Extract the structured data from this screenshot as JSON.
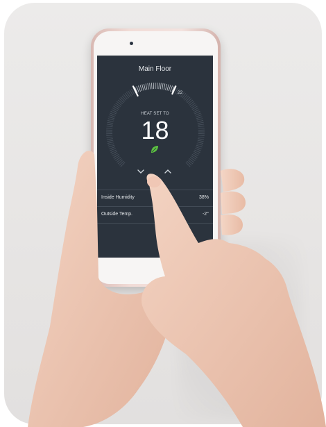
{
  "thermostat": {
    "title": "Main Floor",
    "mode_label": "HEAT SET TO",
    "setpoint": "18",
    "dial_mark": "22",
    "leaf_icon": "leaf-icon",
    "down_icon": "chevron-down-icon",
    "up_icon": "chevron-up-icon"
  },
  "readings": [
    {
      "label": "Inside Humidity",
      "value": "38%"
    },
    {
      "label": "Outside Temp.",
      "value": "-2°"
    }
  ],
  "colors": {
    "screen_bg": "#2b333d",
    "leaf": "#5cc241",
    "phone_body": "#f1dcd7",
    "background": "#ecebea"
  }
}
